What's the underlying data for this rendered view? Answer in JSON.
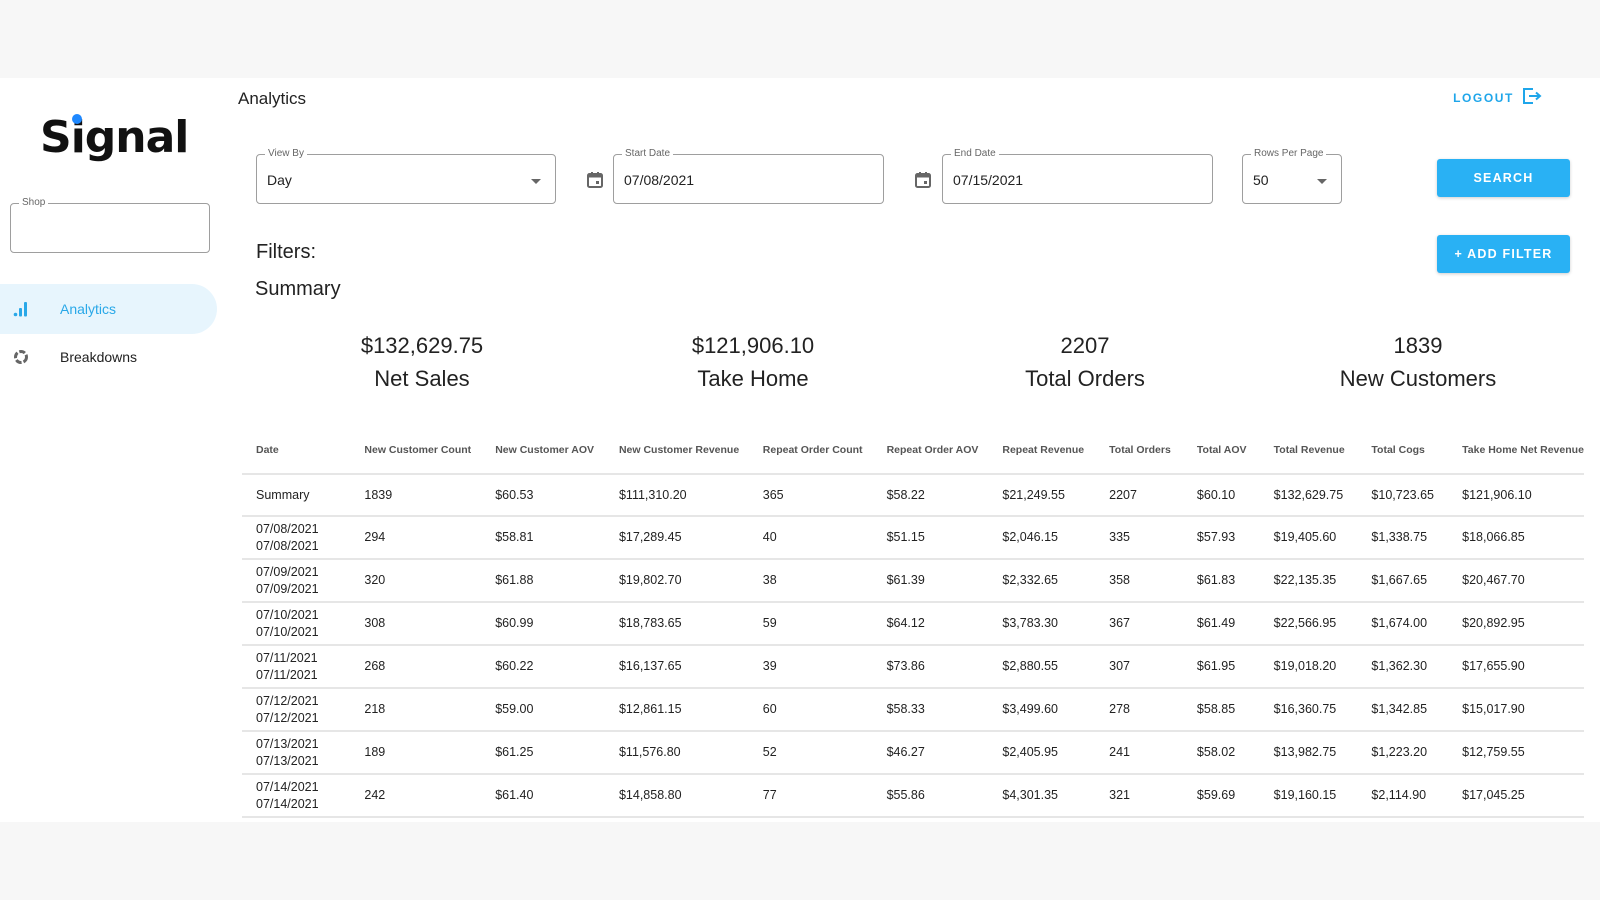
{
  "app": {
    "name": "Signal",
    "accent": "#29b1f4",
    "logo_dot": "#1e88ff"
  },
  "header": {
    "title": "Analytics",
    "logout_label": "LOGOUT",
    "logout_icon": "logout-icon"
  },
  "sidebar": {
    "shop_field": {
      "label": "Shop",
      "value": ""
    },
    "items": [
      {
        "label": "Analytics",
        "icon": "bar-chart-icon",
        "active": true
      },
      {
        "label": "Breakdowns",
        "icon": "donut-icon",
        "active": false
      }
    ]
  },
  "controls": {
    "view_by": {
      "label": "View By",
      "value": "Day"
    },
    "start_date": {
      "label": "Start Date",
      "value": "07/08/2021",
      "icon": "calendar-icon"
    },
    "end_date": {
      "label": "End Date",
      "value": "07/15/2021",
      "icon": "calendar-icon"
    },
    "rows_per_page": {
      "label": "Rows Per Page",
      "value": "50"
    },
    "search_label": "SEARCH",
    "add_filter_label": "+ ADD FILTER"
  },
  "filters_label": "Filters:",
  "summary": {
    "title": "Summary",
    "stats": [
      {
        "value": "$132,629.75",
        "label": "Net Sales"
      },
      {
        "value": "$121,906.10",
        "label": "Take Home"
      },
      {
        "value": "2207",
        "label": "Total Orders"
      },
      {
        "value": "1839",
        "label": "New Customers"
      }
    ]
  },
  "table": {
    "columns": [
      "Date",
      "New Customer Count",
      "New Customer AOV",
      "New Customer Revenue",
      "Repeat Order Count",
      "Repeat Order AOV",
      "Repeat Revenue",
      "Total Orders",
      "Total AOV",
      "Total Revenue",
      "Total Cogs",
      "Take Home Net Revenue"
    ],
    "summary_row": [
      "Summary",
      "1839",
      "$60.53",
      "$111,310.20",
      "365",
      "$58.22",
      "$21,249.55",
      "2207",
      "$60.10",
      "$132,629.75",
      "$10,723.65",
      "$121,906.10"
    ],
    "rows": [
      {
        "date_start": "07/08/2021",
        "date_end": "07/08/2021",
        "cells": [
          "294",
          "$58.81",
          "$17,289.45",
          "40",
          "$51.15",
          "$2,046.15",
          "335",
          "$57.93",
          "$19,405.60",
          "$1,338.75",
          "$18,066.85"
        ]
      },
      {
        "date_start": "07/09/2021",
        "date_end": "07/09/2021",
        "cells": [
          "320",
          "$61.88",
          "$19,802.70",
          "38",
          "$61.39",
          "$2,332.65",
          "358",
          "$61.83",
          "$22,135.35",
          "$1,667.65",
          "$20,467.70"
        ]
      },
      {
        "date_start": "07/10/2021",
        "date_end": "07/10/2021",
        "cells": [
          "308",
          "$60.99",
          "$18,783.65",
          "59",
          "$64.12",
          "$3,783.30",
          "367",
          "$61.49",
          "$22,566.95",
          "$1,674.00",
          "$20,892.95"
        ]
      },
      {
        "date_start": "07/11/2021",
        "date_end": "07/11/2021",
        "cells": [
          "268",
          "$60.22",
          "$16,137.65",
          "39",
          "$73.86",
          "$2,880.55",
          "307",
          "$61.95",
          "$19,018.20",
          "$1,362.30",
          "$17,655.90"
        ]
      },
      {
        "date_start": "07/12/2021",
        "date_end": "07/12/2021",
        "cells": [
          "218",
          "$59.00",
          "$12,861.15",
          "60",
          "$58.33",
          "$3,499.60",
          "278",
          "$58.85",
          "$16,360.75",
          "$1,342.85",
          "$15,017.90"
        ]
      },
      {
        "date_start": "07/13/2021",
        "date_end": "07/13/2021",
        "cells": [
          "189",
          "$61.25",
          "$11,576.80",
          "52",
          "$46.27",
          "$2,405.95",
          "241",
          "$58.02",
          "$13,982.75",
          "$1,223.20",
          "$12,759.55"
        ]
      },
      {
        "date_start": "07/14/2021",
        "date_end": "07/14/2021",
        "cells": [
          "242",
          "$61.40",
          "$14,858.80",
          "77",
          "$55.86",
          "$4,301.35",
          "321",
          "$59.69",
          "$19,160.15",
          "$2,114.90",
          "$17,045.25"
        ]
      }
    ]
  }
}
